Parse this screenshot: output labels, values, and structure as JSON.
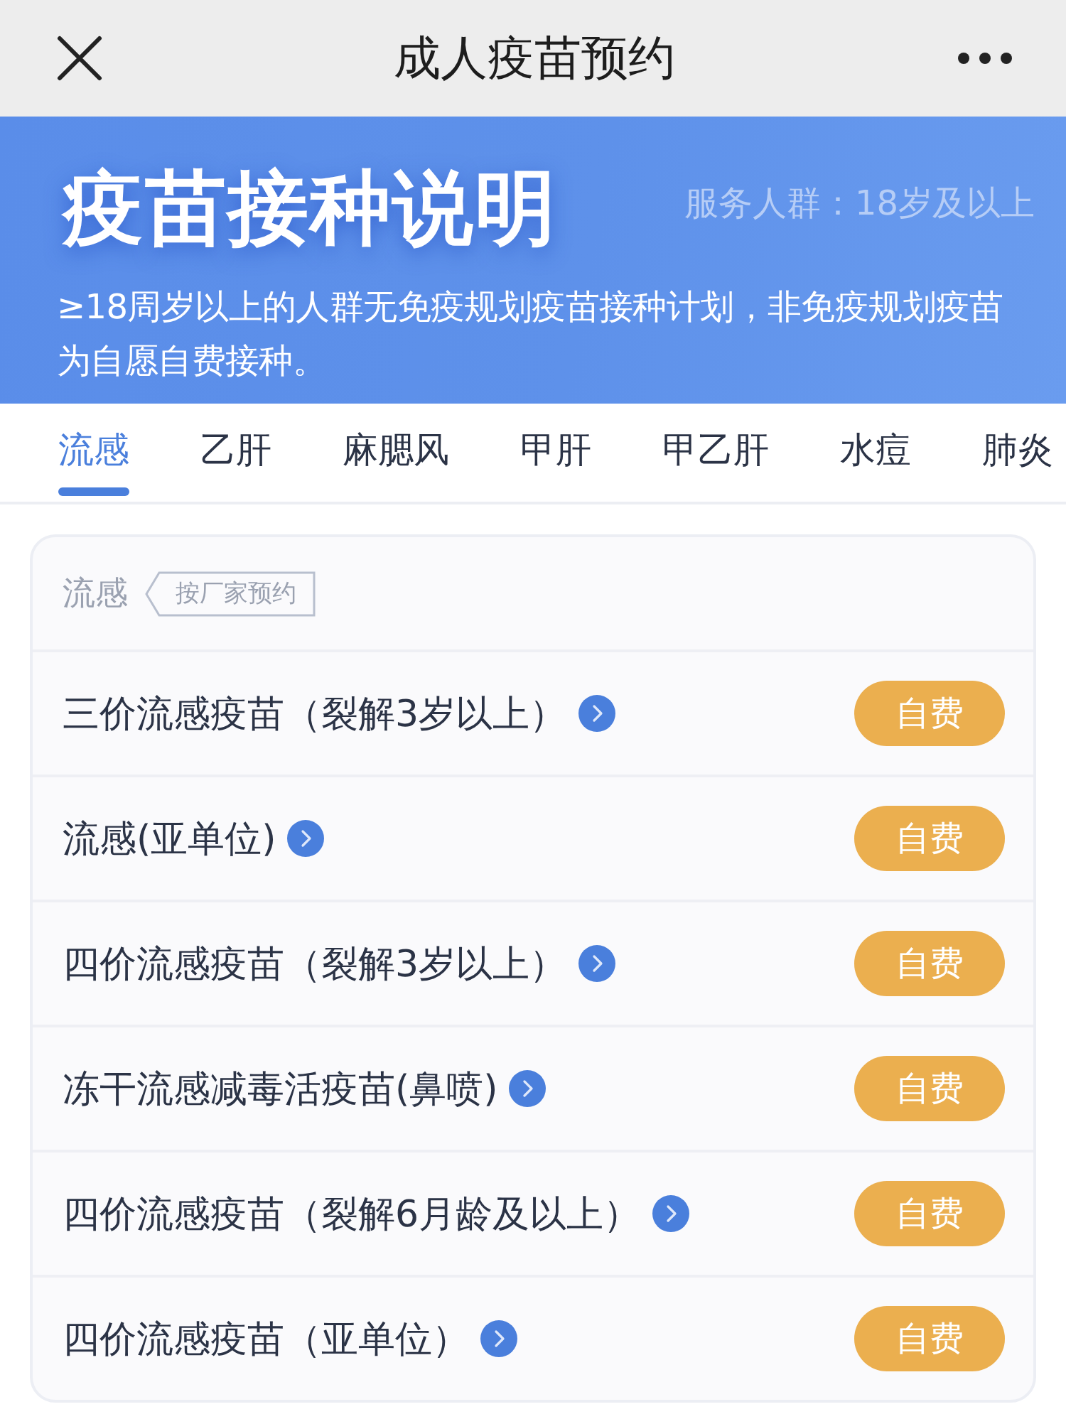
{
  "top_bar": {
    "title": "成人疫苗预约"
  },
  "banner": {
    "title": "疫苗接种说明",
    "audience": "服务人群：18岁及以上",
    "description": "≥18周岁以上的人群无免疫规划疫苗接种计划，非免疫规划疫苗为自愿自费接种。"
  },
  "tabs": [
    {
      "label": "流感",
      "selected": true
    },
    {
      "label": "乙肝",
      "selected": false
    },
    {
      "label": "麻腮风",
      "selected": false
    },
    {
      "label": "甲肝",
      "selected": false
    },
    {
      "label": "甲乙肝",
      "selected": false
    },
    {
      "label": "水痘",
      "selected": false
    },
    {
      "label": "肺炎",
      "selected": false
    }
  ],
  "section": {
    "title": "流感",
    "tag": "按厂家预约",
    "vaccines": [
      {
        "name": "三价流感疫苗（裂解3岁以上）",
        "action": "自费"
      },
      {
        "name": "流感(亚单位)",
        "action": "自费"
      },
      {
        "name": "四价流感疫苗（裂解3岁以上）",
        "action": "自费"
      },
      {
        "name": "冻干流感减毒活疫苗(鼻喷)",
        "action": "自费"
      },
      {
        "name": "四价流感疫苗（裂解6月龄及以上）",
        "action": "自费"
      },
      {
        "name": "四价流感疫苗（亚单位）",
        "action": "自费"
      }
    ]
  }
}
